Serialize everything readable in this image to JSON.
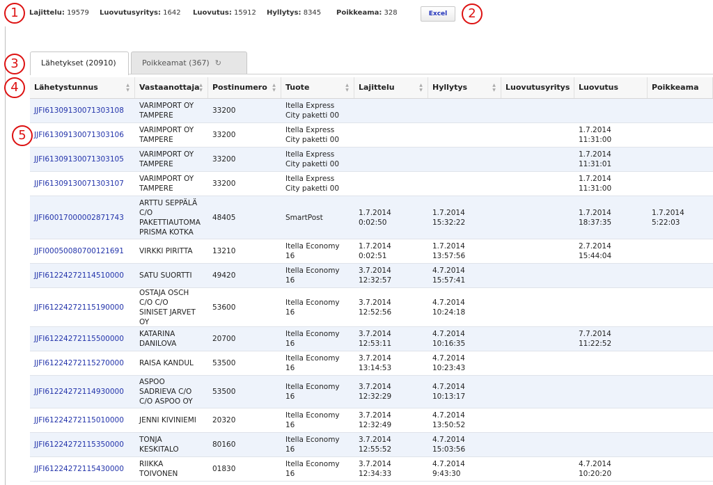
{
  "stats": [
    {
      "label": "Lajittelu:",
      "value": "19579"
    },
    {
      "label": "Luovutusyritys:",
      "value": "1642"
    },
    {
      "label": "Luovutus:",
      "value": "15912"
    },
    {
      "label": "Hyllytys:",
      "value": "8345"
    },
    {
      "label": "Poikkeama:",
      "value": "328"
    }
  ],
  "excel_label": "Excel",
  "markers": [
    "1",
    "2",
    "3",
    "4",
    "5"
  ],
  "tabs": [
    {
      "label": "Lähetykset (20910)",
      "active": true
    },
    {
      "label": "Poikkeamat (367)",
      "active": false,
      "icon": "refresh-icon"
    }
  ],
  "columns": [
    "Lähetystunnus",
    "Vastaanottaja",
    "Postinumero",
    "Tuote",
    "Lajittelu",
    "Hyllytys",
    "Luovutusyritys",
    "Luovutus",
    "Poikkeama"
  ],
  "rows": [
    [
      "JJFI61309130071303108",
      "VARIMPORT OY\nTAMPERE",
      "33200",
      "Itella Express\nCity paketti 00",
      "",
      "",
      "",
      "",
      ""
    ],
    [
      "JJFI61309130071303106",
      "VARIMPORT OY\nTAMPERE",
      "33200",
      "Itella Express\nCity paketti 00",
      "",
      "",
      "",
      "1.7.2014\n11:31:00",
      ""
    ],
    [
      "JJFI61309130071303105",
      "VARIMPORT OY\nTAMPERE",
      "33200",
      "Itella Express\nCity paketti 00",
      "",
      "",
      "",
      "1.7.2014\n11:31:01",
      ""
    ],
    [
      "JJFI61309130071303107",
      "VARIMPORT OY\nTAMPERE",
      "33200",
      "Itella Express\nCity paketti 00",
      "",
      "",
      "",
      "1.7.2014\n11:31:00",
      ""
    ],
    [
      "JJFI60017000002871743",
      "ARTTU SEPPÄLÄ\nC/O\nPAKETTIAUTOMA\nPRISMA KOTKA",
      "48405",
      "SmartPost",
      "1.7.2014\n0:02:50",
      "1.7.2014\n15:32:22",
      "",
      "1.7.2014\n18:37:35",
      "1.7.2014\n5:22:03"
    ],
    [
      "JJFI00050080700121691",
      "VIRKKI PIRITTA",
      "13210",
      "Itella Economy\n16",
      "1.7.2014\n0:02:51",
      "1.7.2014\n13:57:56",
      "",
      "2.7.2014\n15:44:04",
      ""
    ],
    [
      "JJFI61224272114510000",
      "SATU SUORTTI",
      "49420",
      "Itella Economy\n16",
      "3.7.2014\n12:32:57",
      "4.7.2014\n15:57:41",
      "",
      "",
      ""
    ],
    [
      "JJFI61224272115190000",
      "OSTAJA OSCH\nC/O C/O\nSINISET JARVET\nOY",
      "53600",
      "Itella Economy\n16",
      "3.7.2014\n12:52:56",
      "4.7.2014\n10:24:18",
      "",
      "",
      ""
    ],
    [
      "JJFI61224272115500000",
      "KATARINA\nDANILOVA",
      "20700",
      "Itella Economy\n16",
      "3.7.2014\n12:53:11",
      "4.7.2014\n10:16:35",
      "",
      "7.7.2014\n11:22:52",
      ""
    ],
    [
      "JJFI61224272115270000",
      "RAISA KANDUL",
      "53500",
      "Itella Economy\n16",
      "3.7.2014\n13:14:53",
      "4.7.2014\n10:23:43",
      "",
      "",
      ""
    ],
    [
      "JJFI61224272114930000",
      "ASPOO\nSADRIEVA C/O\nC/O ASPOO OY",
      "53500",
      "Itella Economy\n16",
      "3.7.2014\n12:32:29",
      "4.7.2014\n10:13:17",
      "",
      "",
      ""
    ],
    [
      "JJFI61224272115010000",
      "JENNI KIVINIEMI",
      "20320",
      "Itella Economy\n16",
      "3.7.2014\n12:32:49",
      "4.7.2014\n13:50:52",
      "",
      "",
      ""
    ],
    [
      "JJFI61224272115350000",
      "TONJA\nKESKITALO",
      "80160",
      "Itella Economy\n16",
      "3.7.2014\n12:55:52",
      "4.7.2014\n15:03:56",
      "",
      "",
      ""
    ],
    [
      "JJFI61224272115430000",
      "RIIKKA\nTOIVONEN",
      "01830",
      "Itella Economy\n16",
      "3.7.2014\n12:34:33",
      "4.7.2014\n9:43:30",
      "",
      "4.7.2014\n10:20:20",
      ""
    ]
  ]
}
